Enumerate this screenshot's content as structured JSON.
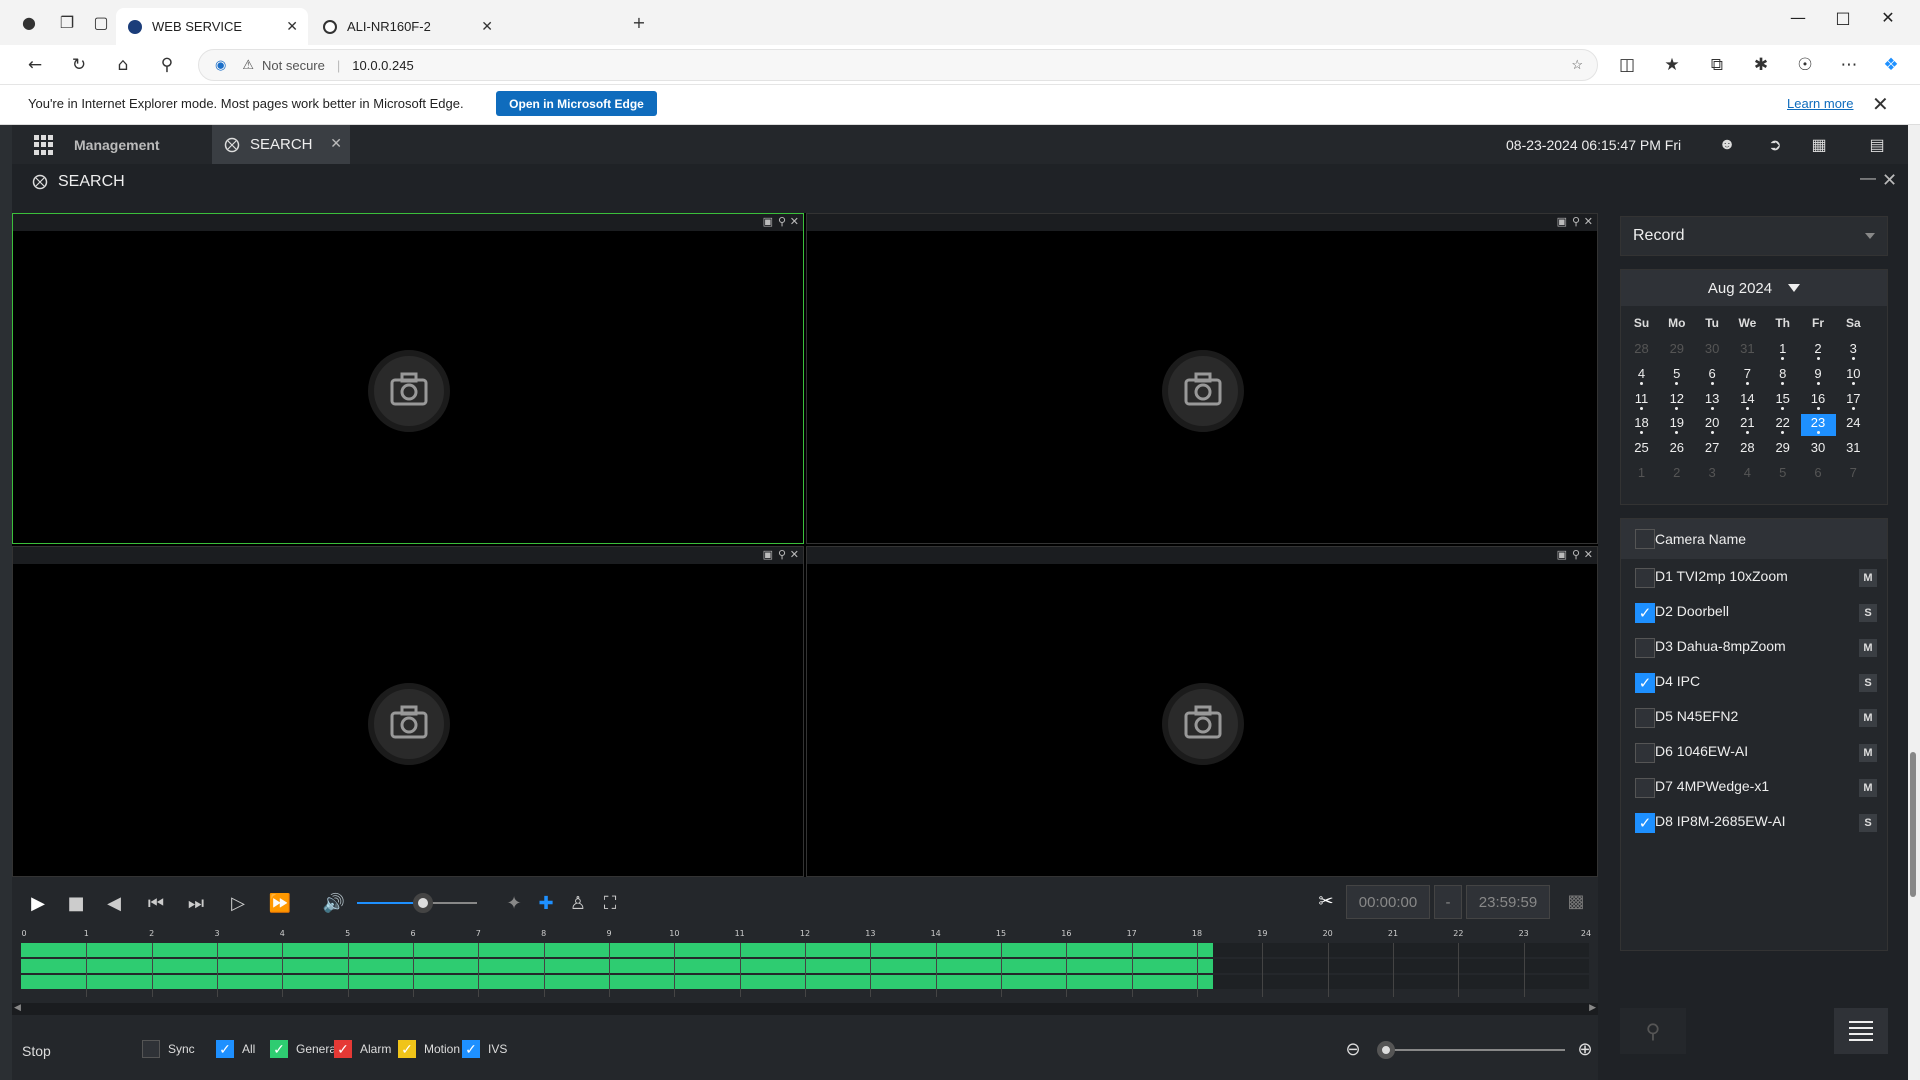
{
  "browser": {
    "tabs": [
      {
        "label": "WEB SERVICE",
        "active": true
      },
      {
        "label": "ALI-NR160F-2",
        "active": false
      }
    ],
    "address": {
      "security_label": "Not secure",
      "url": "10.0.0.245"
    },
    "ie_bar": {
      "message": "You're in Internet Explorer mode. Most pages work better in Microsoft Edge.",
      "open_button": "Open in Microsoft Edge",
      "learn_more": "Learn more"
    }
  },
  "app": {
    "menu_label": "Management",
    "active_tab": "SEARCH",
    "datetime": "08-23-2024 06:15:47 PM Fri",
    "panel_title": "SEARCH",
    "accent": "#1e90ff",
    "record_green": "#2ecc71"
  },
  "controls": {
    "volume_level": 0.55,
    "clip_start": "00:00:00",
    "clip_sep": "-",
    "clip_end": "23:59:59"
  },
  "timeline": {
    "hours": [
      "0",
      "1",
      "2",
      "3",
      "4",
      "5",
      "6",
      "7",
      "8",
      "9",
      "10",
      "11",
      "12",
      "13",
      "14",
      "15",
      "16",
      "17",
      "18",
      "19",
      "20",
      "21",
      "22",
      "23",
      "24"
    ],
    "recorded_until_hour": 18.25,
    "rows": 3
  },
  "status": {
    "state": "Stop",
    "filters": [
      {
        "label": "Sync",
        "checked": false,
        "color": "#2f3237"
      },
      {
        "label": "All",
        "checked": true,
        "color": "#1e90ff"
      },
      {
        "label": "General",
        "checked": true,
        "color": "#2ecc71"
      },
      {
        "label": "Alarm",
        "checked": true,
        "color": "#e53935"
      },
      {
        "label": "Motion",
        "checked": true,
        "color": "#f0c419"
      },
      {
        "label": "IVS",
        "checked": true,
        "color": "#1e90ff"
      }
    ],
    "zoom_level": 0
  },
  "search": {
    "record_type": "Record",
    "calendar": {
      "month_label": "Aug 2024",
      "weekdays": [
        "Su",
        "Mo",
        "Tu",
        "We",
        "Th",
        "Fr",
        "Sa"
      ],
      "weeks": [
        [
          {
            "d": "28",
            "dim": true
          },
          {
            "d": "29",
            "dim": true
          },
          {
            "d": "30",
            "dim": true
          },
          {
            "d": "31",
            "dim": true
          },
          {
            "d": "1",
            "dot": true
          },
          {
            "d": "2",
            "dot": true
          },
          {
            "d": "3",
            "dot": true
          }
        ],
        [
          {
            "d": "4",
            "dot": true
          },
          {
            "d": "5",
            "dot": true
          },
          {
            "d": "6",
            "dot": true
          },
          {
            "d": "7",
            "dot": true
          },
          {
            "d": "8",
            "dot": true
          },
          {
            "d": "9",
            "dot": true
          },
          {
            "d": "10",
            "dot": true
          }
        ],
        [
          {
            "d": "11",
            "dot": true
          },
          {
            "d": "12",
            "dot": true
          },
          {
            "d": "13",
            "dot": true
          },
          {
            "d": "14",
            "dot": true
          },
          {
            "d": "15",
            "dot": true
          },
          {
            "d": "16",
            "dot": true
          },
          {
            "d": "17",
            "dot": true
          }
        ],
        [
          {
            "d": "18",
            "dot": true
          },
          {
            "d": "19",
            "dot": true
          },
          {
            "d": "20",
            "dot": true
          },
          {
            "d": "21",
            "dot": true
          },
          {
            "d": "22",
            "dot": true
          },
          {
            "d": "23",
            "dot": true,
            "selected": true
          },
          {
            "d": "24"
          }
        ],
        [
          {
            "d": "25"
          },
          {
            "d": "26"
          },
          {
            "d": "27"
          },
          {
            "d": "28"
          },
          {
            "d": "29"
          },
          {
            "d": "30"
          },
          {
            "d": "31"
          }
        ],
        [
          {
            "d": "1",
            "dim": true
          },
          {
            "d": "2",
            "dim": true
          },
          {
            "d": "3",
            "dim": true
          },
          {
            "d": "4",
            "dim": true
          },
          {
            "d": "5",
            "dim": true
          },
          {
            "d": "6",
            "dim": true
          },
          {
            "d": "7",
            "dim": true
          }
        ]
      ]
    },
    "camera_header": "Camera Name",
    "cameras": [
      {
        "name": "D1 TVI2mp 10xZoom",
        "checked": false,
        "stream": "M"
      },
      {
        "name": "D2 Doorbell",
        "checked": true,
        "stream": "S"
      },
      {
        "name": "D3 Dahua-8mpZoom",
        "checked": false,
        "stream": "M"
      },
      {
        "name": "D4 IPC",
        "checked": true,
        "stream": "S"
      },
      {
        "name": "D5 N45EFN2",
        "checked": false,
        "stream": "M"
      },
      {
        "name": "D6 1046EW-AI",
        "checked": false,
        "stream": "M"
      },
      {
        "name": "D7 4MPWedge-x1",
        "checked": false,
        "stream": "M"
      },
      {
        "name": "D8 IP8M-2685EW-AI",
        "checked": true,
        "stream": "S"
      }
    ]
  }
}
